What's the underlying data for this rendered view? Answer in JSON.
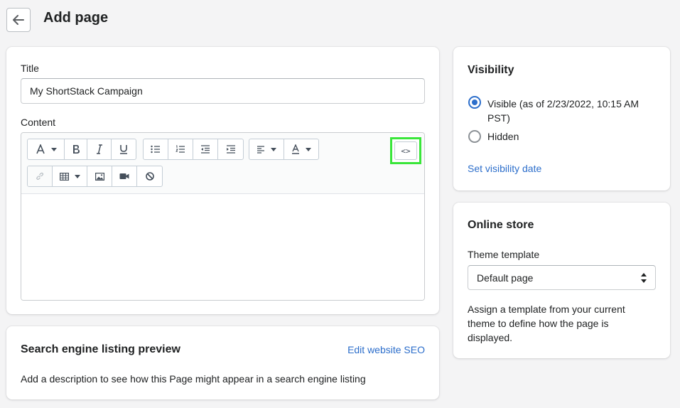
{
  "header": {
    "title": "Add page"
  },
  "main": {
    "title_label": "Title",
    "title_value": "My ShortStack Campaign",
    "content_label": "Content",
    "toolbar": {
      "html_button_label": "<>"
    }
  },
  "seo": {
    "heading": "Search engine listing preview",
    "edit_link": "Edit website SEO",
    "description": "Add a description to see how this Page might appear in a search engine listing"
  },
  "visibility": {
    "heading": "Visibility",
    "visible_label_line1": "Visible (as of 2/23/2022, 10:15 AM",
    "visible_label_line2": "PST)",
    "hidden_label": "Hidden",
    "set_date_link": "Set visibility date"
  },
  "online_store": {
    "heading": "Online store",
    "template_label": "Theme template",
    "template_value": "Default page",
    "help_line1": "Assign a template from your current",
    "help_line2": "theme to define how the page is",
    "help_line3": "displayed."
  },
  "colors": {
    "highlight": "#39e639",
    "link": "#2c6ecb"
  }
}
